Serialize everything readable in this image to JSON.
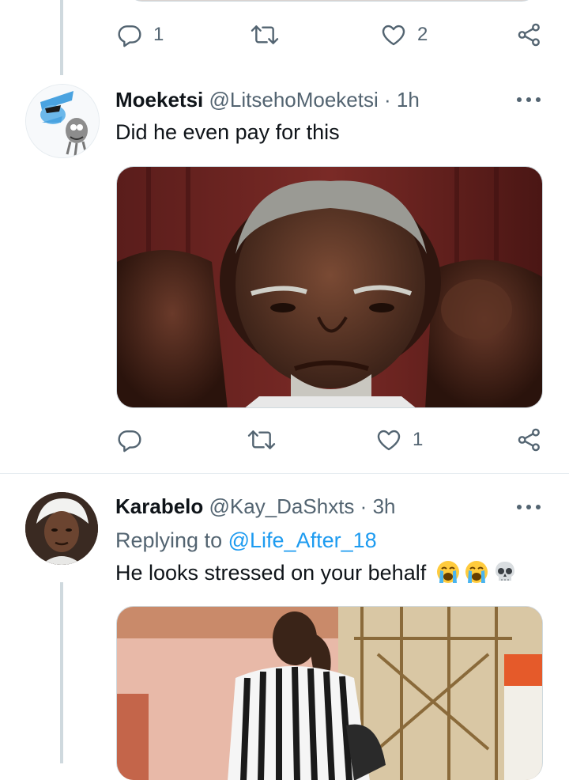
{
  "top_tweet": {
    "actions": {
      "reply_count": "1",
      "retweet_count": "",
      "like_count": "2"
    }
  },
  "tweet1": {
    "name": "Moeketsi",
    "handle": "@LitsehoMoeketsi",
    "separator": "·",
    "time": "1h",
    "text": "Did he even pay for this",
    "actions": {
      "reply_count": "",
      "retweet_count": "",
      "like_count": "1"
    },
    "icons": [
      "more-icon",
      "reply-icon",
      "retweet-icon",
      "like-icon",
      "share-icon"
    ]
  },
  "tweet2": {
    "name": "Karabelo",
    "handle": "@Kay_DaShxts",
    "separator": "·",
    "time": "3h",
    "replying_prefix": "Replying to",
    "replying_to": "@Life_After_18",
    "text": "He looks stressed on your behalf",
    "emojis": [
      "loudly-crying-face",
      "loudly-crying-face",
      "skull"
    ]
  },
  "colors": {
    "accent": "#1d9bf0",
    "secondary_text": "#536471",
    "thread_line": "#cfd9de"
  }
}
